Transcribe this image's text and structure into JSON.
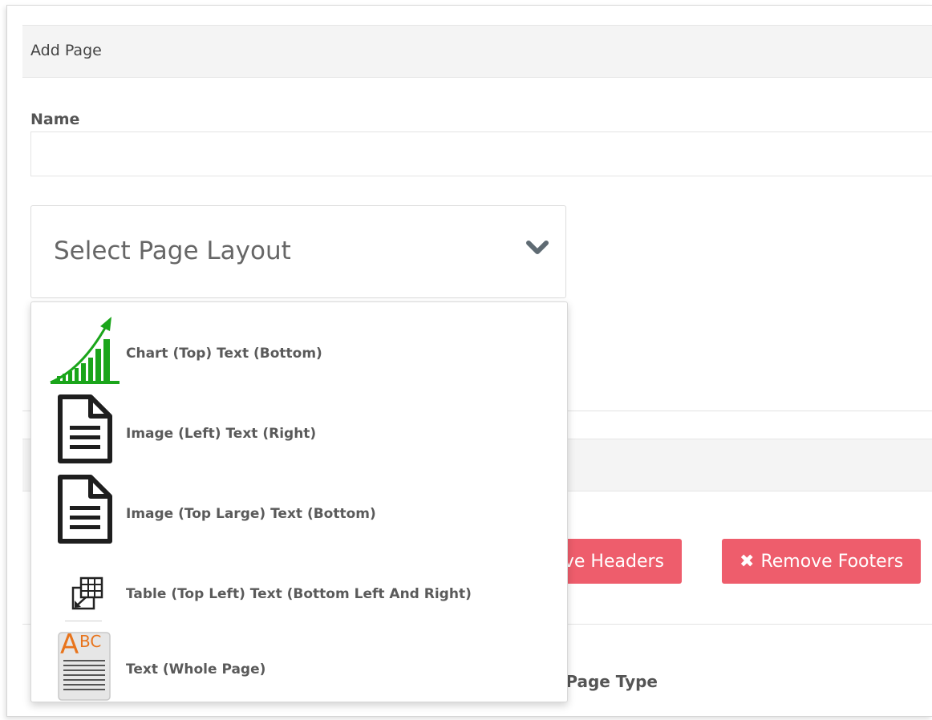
{
  "panel": {
    "title": "Add Page"
  },
  "form": {
    "name_label": "Name",
    "name_value": "",
    "layout_placeholder": "Select Page Layout"
  },
  "dropdown": {
    "options": [
      {
        "label": "Chart (Top) Text (Bottom)",
        "icon": "chart-icon"
      },
      {
        "label": "Image (Left) Text (Right)",
        "icon": "document-icon"
      },
      {
        "label": "Image (Top Large) Text (Bottom)",
        "icon": "document-icon"
      },
      {
        "label": "Table (Top Left) Text (Bottom Left And Right)",
        "icon": "table-icon"
      },
      {
        "label": "Text (Whole Page)",
        "icon": "text-abc-icon"
      }
    ]
  },
  "buttons": {
    "remove_headers": "Remove Headers",
    "remove_footers": "Remove Footers",
    "remove_icon": "✖"
  },
  "page_type_label": "Page Type",
  "colors": {
    "danger": "#ee5d6c",
    "chart_green": "#1aa51a",
    "abc_orange": "#e8741c"
  }
}
